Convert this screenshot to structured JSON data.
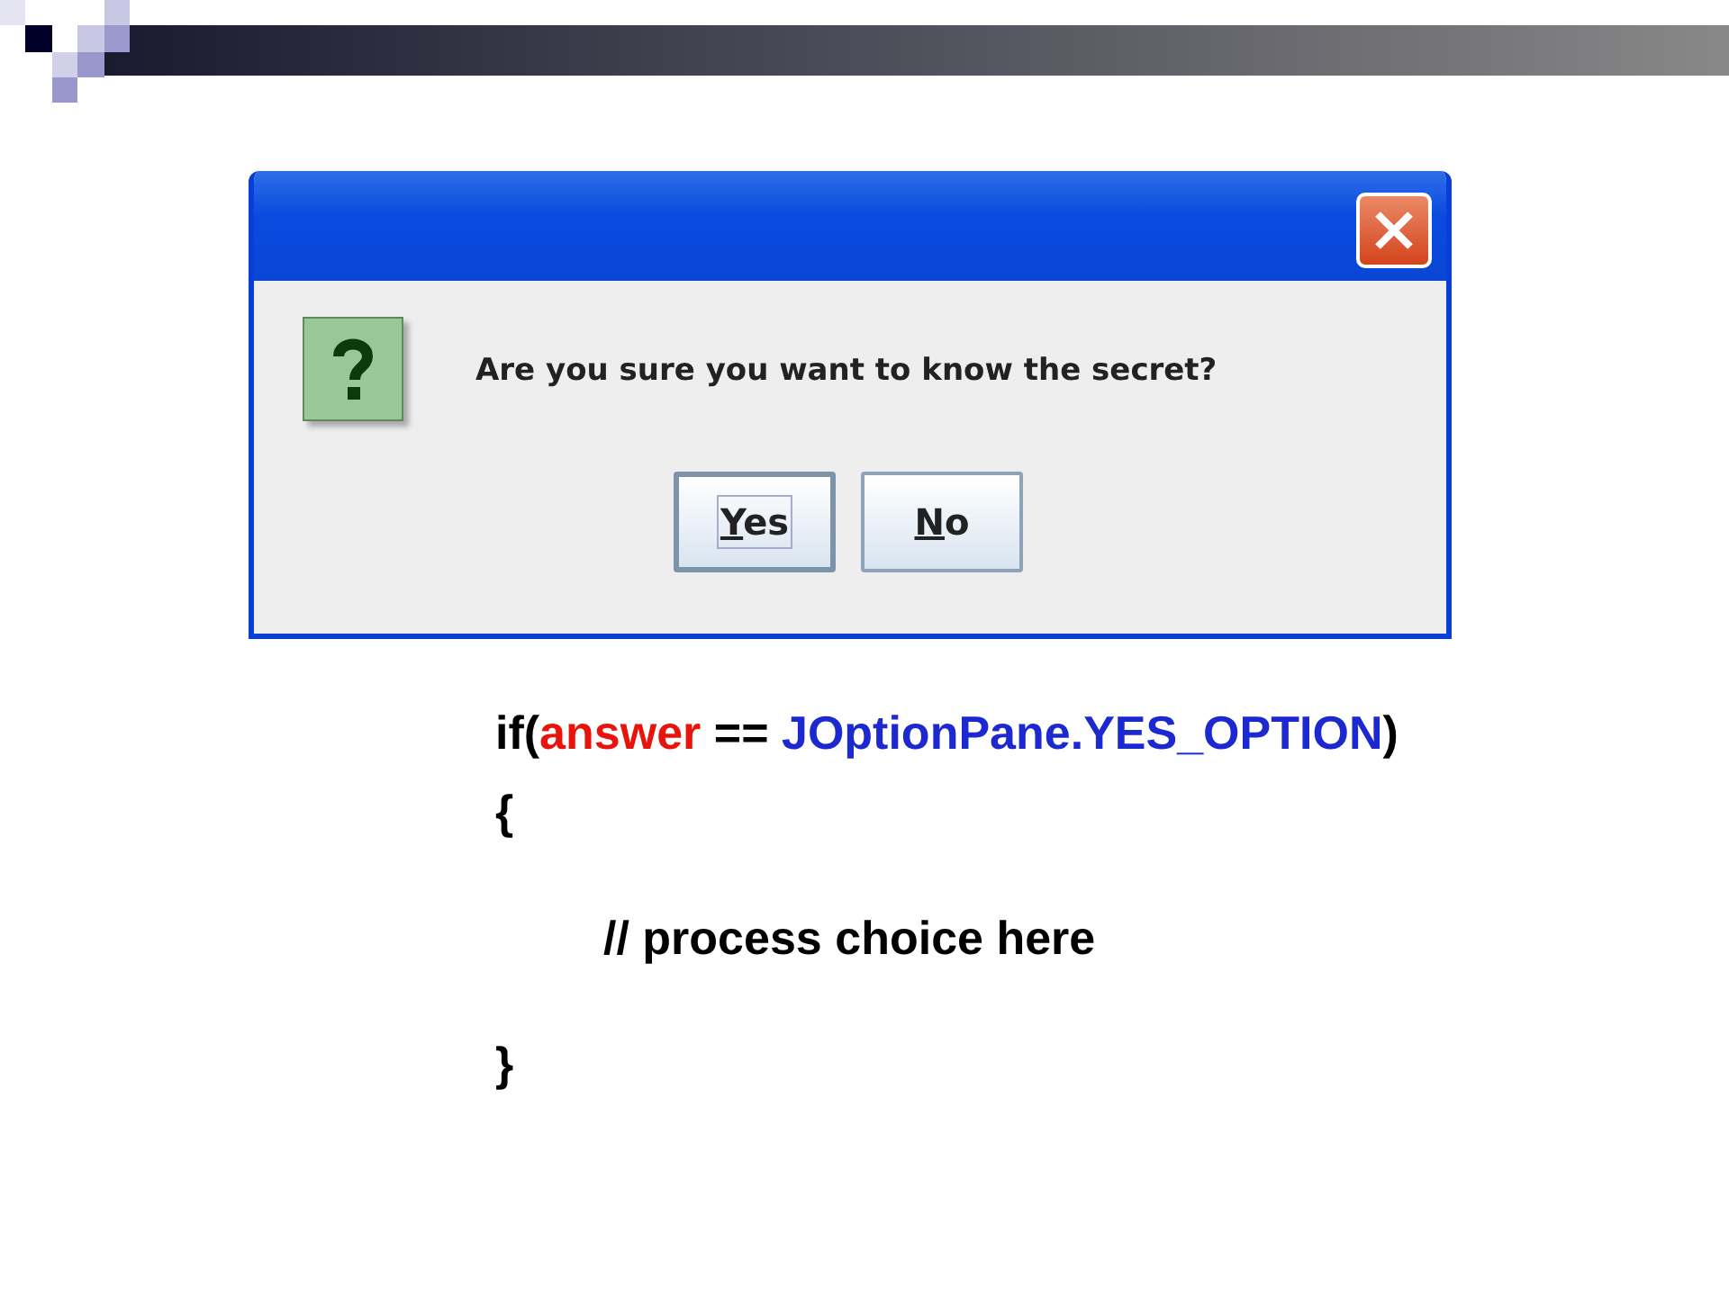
{
  "dialog": {
    "message": "Are you sure you want to know the secret?",
    "buttons": [
      {
        "label": "Yes",
        "focused": true
      },
      {
        "label": "No",
        "focused": false
      }
    ]
  },
  "code": [
    {
      "kind": "line",
      "parts": [
        {
          "text": "if(",
          "color": "#000000"
        },
        {
          "text": "answer",
          "color": "#e8140c"
        },
        {
          "text": " == ",
          "color": "#000000"
        },
        {
          "text": "JOptionPane.YES_OPTION",
          "color": "#1c28d0"
        },
        {
          "text": ")",
          "color": "#000000"
        }
      ]
    },
    {
      "kind": "line",
      "parts": [
        {
          "text": "{",
          "color": "#000000"
        }
      ]
    },
    {
      "kind": "blank"
    },
    {
      "kind": "indented_line",
      "parts": [
        {
          "text": "// process choice here",
          "color": "#000000"
        }
      ]
    },
    {
      "kind": "blank"
    },
    {
      "kind": "line",
      "parts": [
        {
          "text": "}",
          "color": "#000000"
        }
      ]
    }
  ]
}
